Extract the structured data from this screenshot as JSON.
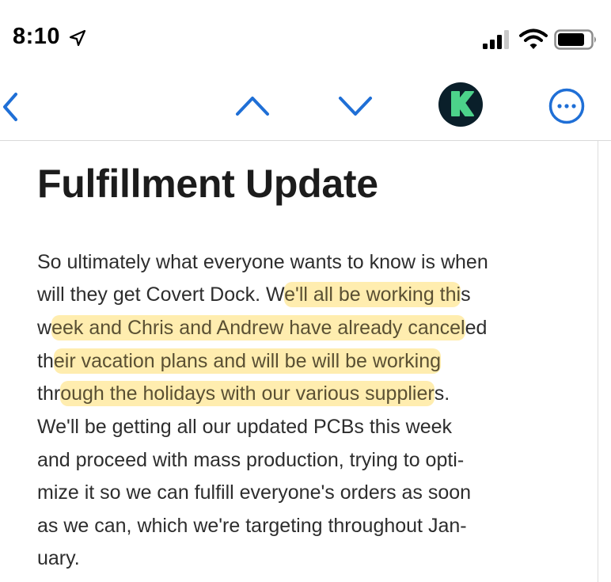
{
  "status_bar": {
    "time": "8:10",
    "icons": [
      "location-arrow-icon",
      "cellular-signal-icon",
      "wifi-icon",
      "battery-icon"
    ]
  },
  "nav_bar": {
    "icons": [
      "chevron-left-icon",
      "chevron-up-icon",
      "chevron-down-icon",
      "sender-avatar",
      "more-icon"
    ],
    "avatar_letter": "K",
    "accent_color": "#1f6fd6",
    "avatar_bg": "#0a1f2a",
    "avatar_letter_color": "#4cd28a"
  },
  "article": {
    "title": "Fulfillment Update",
    "lines": [
      {
        "pre": "So ultimately what everyone wants to know is when",
        "hl": "",
        "post": ""
      },
      {
        "pre": "will they get Covert Dock.  W",
        "hl": "e'll all be working thi",
        "post": "s"
      },
      {
        "pre": "w",
        "hl": "eek and Chris and Andrew have already cancel",
        "post": "ed"
      },
      {
        "pre": "th",
        "hl": "eir vacation plans and will be will be working",
        "post": ""
      },
      {
        "pre": "thr",
        "hl": "ough the holidays with our various supplier",
        "post": "s."
      },
      {
        "pre": " We'll be getting all our updated PCBs this week",
        "hl": "",
        "post": ""
      },
      {
        "pre": "and proceed with mass production, trying to opti-",
        "hl": "",
        "post": ""
      },
      {
        "pre": "mize it so we can fulfill everyone's orders as soon",
        "hl": "",
        "post": ""
      },
      {
        "pre": "as we can, which we're targeting throughout Jan-",
        "hl": "",
        "post": ""
      },
      {
        "pre": "uary.",
        "hl": "",
        "post": ""
      }
    ],
    "highlight_color": "#ffde6e"
  }
}
